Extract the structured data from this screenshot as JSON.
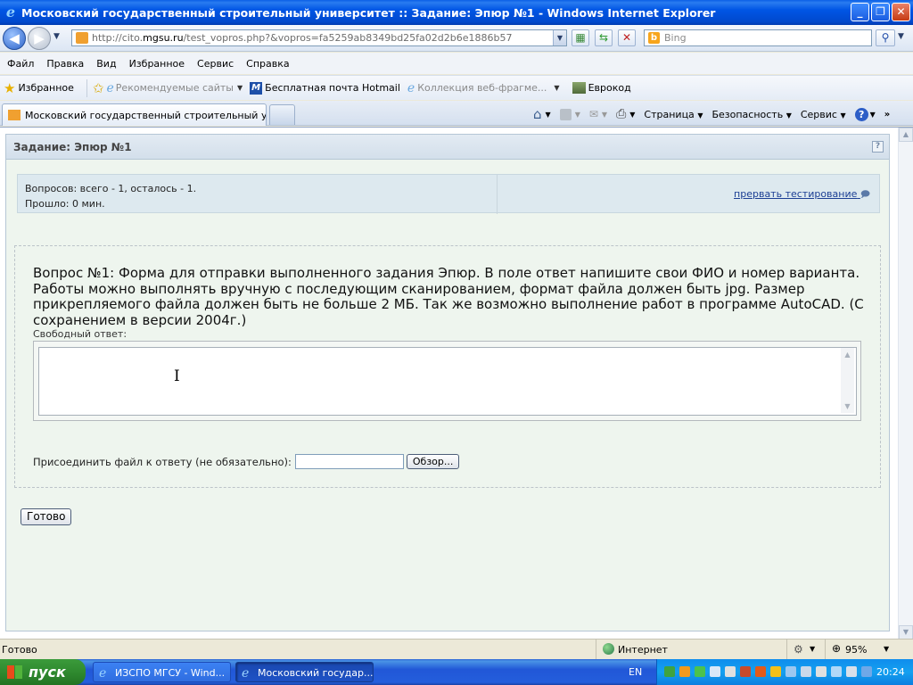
{
  "window": {
    "title": "Московский государственный строительный университет :: Задание: Эпюр №1 - Windows Internet Explorer",
    "minimize": "_",
    "maximize": "❐",
    "close": "✕"
  },
  "address": {
    "url_prefix": "http://cito.",
    "url_host": "mgsu.ru",
    "url_path": "/test_vopros.php?&vopros=fa5259ab8349bd25fa02d2b6e1886b57",
    "search_placeholder": "Bing"
  },
  "menu": [
    "Файл",
    "Правка",
    "Вид",
    "Избранное",
    "Сервис",
    "Справка"
  ],
  "favorites": {
    "label": "Избранное",
    "items": [
      "Рекомендуемые сайты",
      "Бесплатная почта Hotmail",
      "Коллекция веб-фрагме...",
      "Еврокод"
    ]
  },
  "tabs": {
    "active": "Московский государственный строительный унив..."
  },
  "commands": [
    "Страница",
    "Безопасность",
    "Сервис"
  ],
  "page": {
    "title": "Задание: Эпюр №1",
    "help": "?",
    "questions_info": "Вопросов: всего - 1, осталось - 1.",
    "elapsed": "Прошло: 0 мин.",
    "abort_link": "прервать тестирование",
    "question": "Вопрос №1: Форма для отправки выполненного задания Эпюр. В поле ответ напишите свои ФИО и номер варианта. Работы можно выполнять вручную с последующим сканированием, формат файла должен быть jpg. Размер прикрепляемого файла должен быть не больше 2 МБ. Так же возможно выполнение работ в программе AutoCAD. (С сохранением в версии 2004г.)",
    "free_answer_label": "Свободный ответ:",
    "answer_value": "",
    "attach_label": "Присоединить файл к ответу (не обязательно):",
    "browse_button": "Обзор...",
    "done_button": "Готово"
  },
  "status": {
    "text": "Готово",
    "zone": "Интернет",
    "zoom": "95%"
  },
  "taskbar": {
    "start": "пуск",
    "tasks": [
      "ИЗСПО МГСУ - Wind...",
      "Московский государ..."
    ],
    "language": "EN",
    "clock": "20:24"
  }
}
